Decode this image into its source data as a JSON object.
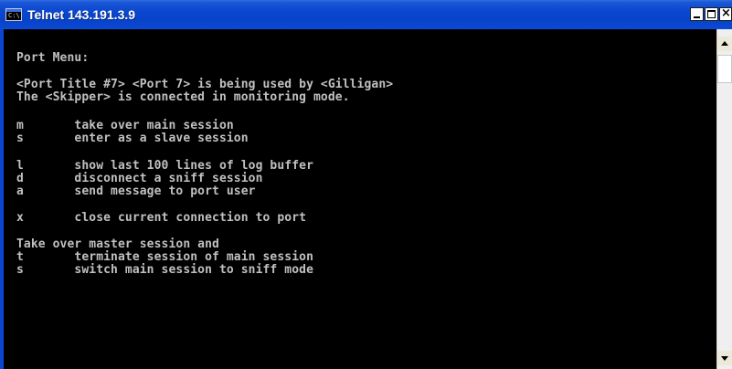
{
  "window": {
    "title": "Telnet 143.191.3.9",
    "icon_label": "C:\\",
    "controls": {
      "minimize_icon": "minimize-icon",
      "maximize_icon": "maximize-icon",
      "close_icon": "close-icon",
      "close_glyph": "×"
    }
  },
  "console": {
    "background": "#000000",
    "text_color": "#c0c0c0",
    "lines": [
      "Port Menu:",
      "<Port Title #7> <Port 7> is being used by <Gilligan>",
      "The <Skipper> is connected in monitoring mode.",
      "m       take over main session",
      "s       enter as a slave session",
      "l       show last 100 lines of log buffer",
      "d       disconnect a sniff session",
      "a       send message to port user",
      "x       close current connection to port",
      "Take over master session and",
      "t       terminate session of main session",
      "s       switch main session to sniff mode"
    ]
  },
  "titlebar_color": "#0a46cf"
}
